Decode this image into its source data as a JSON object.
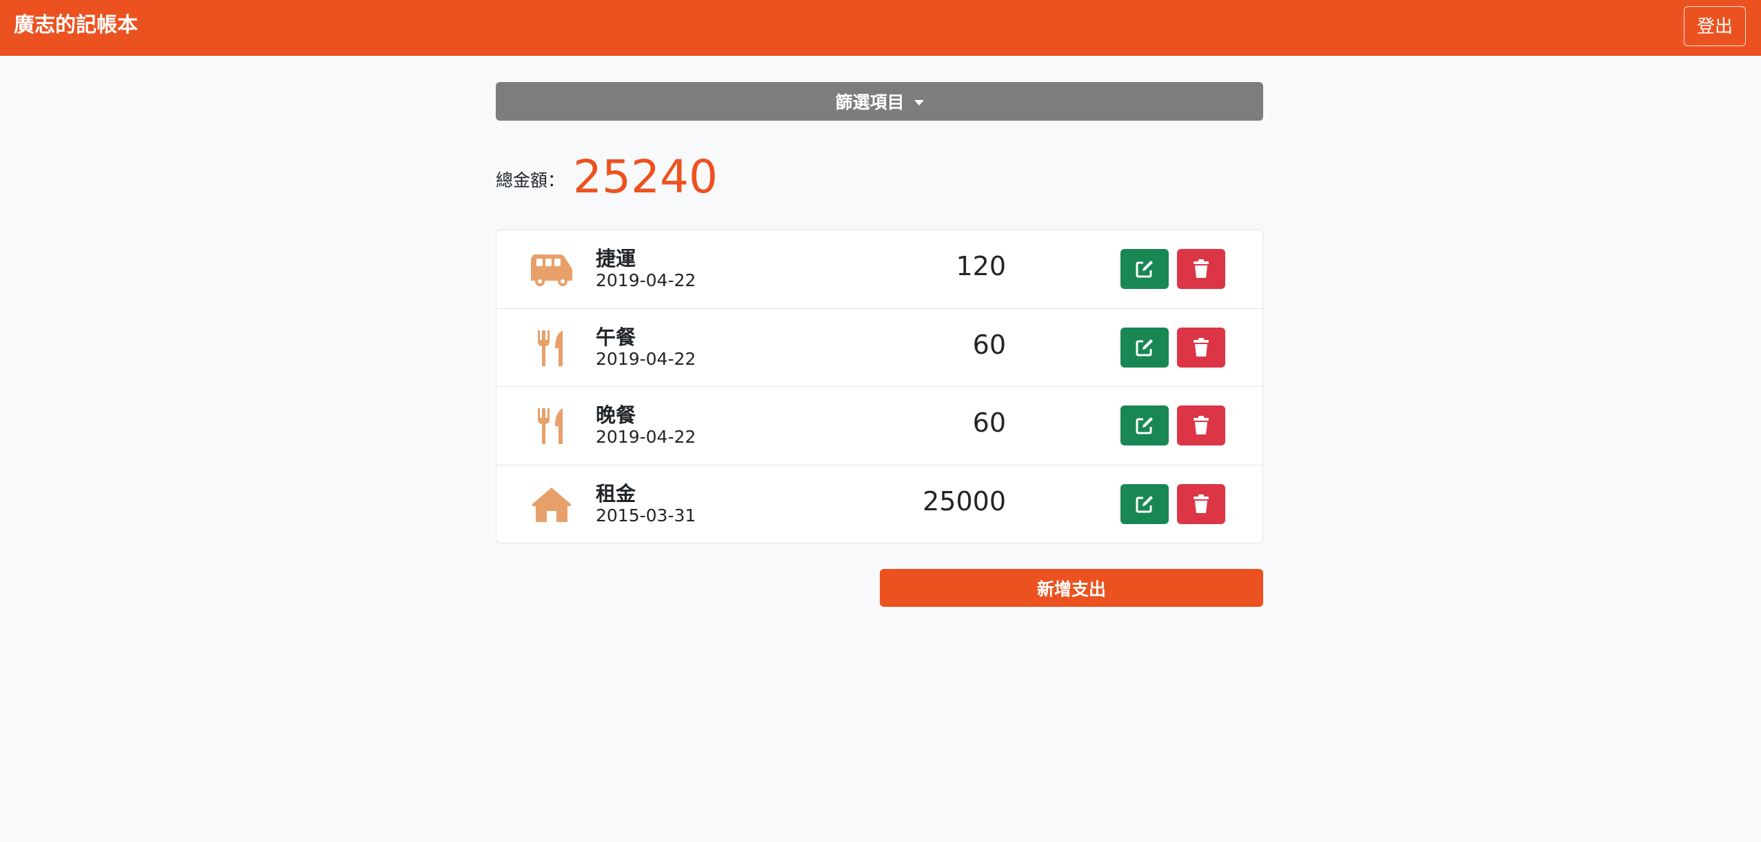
{
  "navbar": {
    "brand": "廣志的記帳本",
    "logout_label": "登出"
  },
  "filter": {
    "label": "篩選項目"
  },
  "summary": {
    "total_label": "總金額：",
    "total_value": "25240"
  },
  "records": [
    {
      "icon": "van-icon",
      "name": "捷運",
      "date": "2019-04-22",
      "amount": "120"
    },
    {
      "icon": "utensils-icon",
      "name": "午餐",
      "date": "2019-04-22",
      "amount": "60"
    },
    {
      "icon": "utensils-icon",
      "name": "晚餐",
      "date": "2019-04-22",
      "amount": "60"
    },
    {
      "icon": "home-icon",
      "name": "租金",
      "date": "2015-03-31",
      "amount": "25000"
    }
  ],
  "add_button": {
    "label": "新增支出"
  },
  "colors": {
    "brand": "#ec5220",
    "icon": "#e8a06a",
    "edit": "#198754",
    "delete": "#dc3545",
    "filter": "#7d7d7d"
  }
}
